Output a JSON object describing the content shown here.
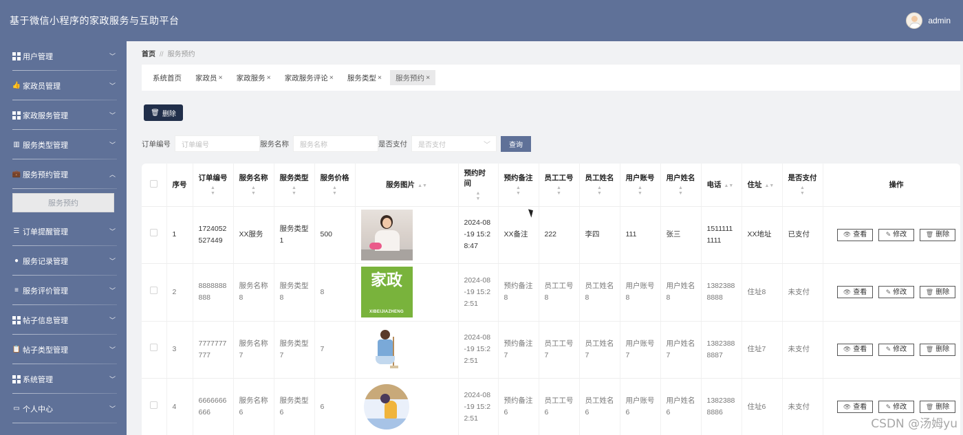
{
  "app": {
    "title": "基于微信小程序的家政服务与互助平台",
    "user": "admin"
  },
  "sidebar": {
    "items": [
      {
        "label": "用户管理",
        "icon": "grid-icon",
        "expanded": false
      },
      {
        "label": "家政员管理",
        "icon": "thumb-icon",
        "expanded": false
      },
      {
        "label": "家政服务管理",
        "icon": "grid-icon",
        "expanded": false
      },
      {
        "label": "服务类型管理",
        "icon": "columns-icon",
        "expanded": false
      },
      {
        "label": "服务预约管理",
        "icon": "briefcase-icon",
        "expanded": true,
        "sub": "服务预约"
      },
      {
        "label": "订单提醒管理",
        "icon": "sliders-icon",
        "expanded": false
      },
      {
        "label": "服务记录管理",
        "icon": "bulb-icon",
        "expanded": false
      },
      {
        "label": "服务评价管理",
        "icon": "list-icon",
        "expanded": false
      },
      {
        "label": "帖子信息管理",
        "icon": "grid-icon",
        "expanded": false
      },
      {
        "label": "帖子类型管理",
        "icon": "clipboard-icon",
        "expanded": false
      },
      {
        "label": "系统管理",
        "icon": "grid-icon",
        "expanded": false
      },
      {
        "label": "个人中心",
        "icon": "card-icon",
        "expanded": false
      }
    ]
  },
  "breadcrumb": {
    "home": "首页",
    "sep": "//",
    "current": "服务预约"
  },
  "tabs": [
    {
      "label": "系统首页",
      "closable": false
    },
    {
      "label": "家政员",
      "closable": true
    },
    {
      "label": "家政服务",
      "closable": true
    },
    {
      "label": "家政服务评论",
      "closable": true
    },
    {
      "label": "服务类型",
      "closable": true
    },
    {
      "label": "服务预约",
      "closable": true,
      "active": true
    }
  ],
  "toolbar": {
    "delete_label": "删除"
  },
  "filters": {
    "order_label": "订单编号",
    "order_placeholder": "订单编号",
    "service_label": "服务名称",
    "service_placeholder": "服务名称",
    "paid_label": "是否支付",
    "paid_placeholder": "是否支付",
    "search_label": "查询"
  },
  "table": {
    "headers": {
      "index": "序号",
      "order_no": "订单编号",
      "service_name": "服务名称",
      "service_type": "服务类型",
      "price": "服务价格",
      "image": "服务图片",
      "time": "预约时间",
      "note": "预约备注",
      "staff_no": "员工工号",
      "staff_name": "员工姓名",
      "account": "用户账号",
      "user_name": "用户姓名",
      "phone": "电话",
      "address": "住址",
      "paid": "是否支付",
      "actions": "操作"
    },
    "actions": {
      "view": "查看",
      "edit": "修改",
      "delete": "删除"
    },
    "rows": [
      {
        "index": "1",
        "order_no": "1724052527449",
        "service_name": "XX服务",
        "service_type": "服务类型1",
        "price": "500",
        "image": "cleaning-woman",
        "time": "2024-08-19 15:28:47",
        "note": "XX备注",
        "staff_no": "222",
        "staff_name": "李四",
        "account": "111",
        "user_name": "张三",
        "phone": "15111111111",
        "address": "XX地址",
        "paid": "已支付"
      },
      {
        "index": "2",
        "order_no": "8888888888",
        "service_name": "服务名称8",
        "service_type": "服务类型8",
        "price": "8",
        "image": "jiazheng-logo",
        "image_text": "家政",
        "image_sub": "XIBEIJIAZHENG",
        "time": "2024-08-19 15:22:51",
        "note": "预约备注8",
        "staff_no": "员工工号8",
        "staff_name": "员工姓名8",
        "account": "用户账号8",
        "user_name": "用户姓名8",
        "phone": "13823888888",
        "address": "住址8",
        "paid": "未支付"
      },
      {
        "index": "3",
        "order_no": "7777777777",
        "service_name": "服务名称7",
        "service_type": "服务类型7",
        "price": "7",
        "image": "mop-maid",
        "time": "2024-08-19 15:22:51",
        "note": "预约备注7",
        "staff_no": "员工工号7",
        "staff_name": "员工姓名7",
        "account": "用户账号7",
        "user_name": "用户姓名7",
        "phone": "13823888887",
        "address": "住址7",
        "paid": "未支付"
      },
      {
        "index": "4",
        "order_no": "6666666666",
        "service_name": "服务名称6",
        "service_type": "服务类型6",
        "price": "6",
        "image": "cleaning-circle",
        "time": "2024-08-19 15:22:51",
        "note": "预约备注6",
        "staff_no": "员工工号6",
        "staff_name": "员工姓名6",
        "account": "用户账号6",
        "user_name": "用户姓名6",
        "phone": "13823888886",
        "address": "住址6",
        "paid": "未支付"
      }
    ]
  },
  "watermark": "CSDN @汤姆yu",
  "colors": {
    "header": "#5f7198",
    "sidebar": "#5f7198",
    "delete_button": "#212f4a"
  }
}
